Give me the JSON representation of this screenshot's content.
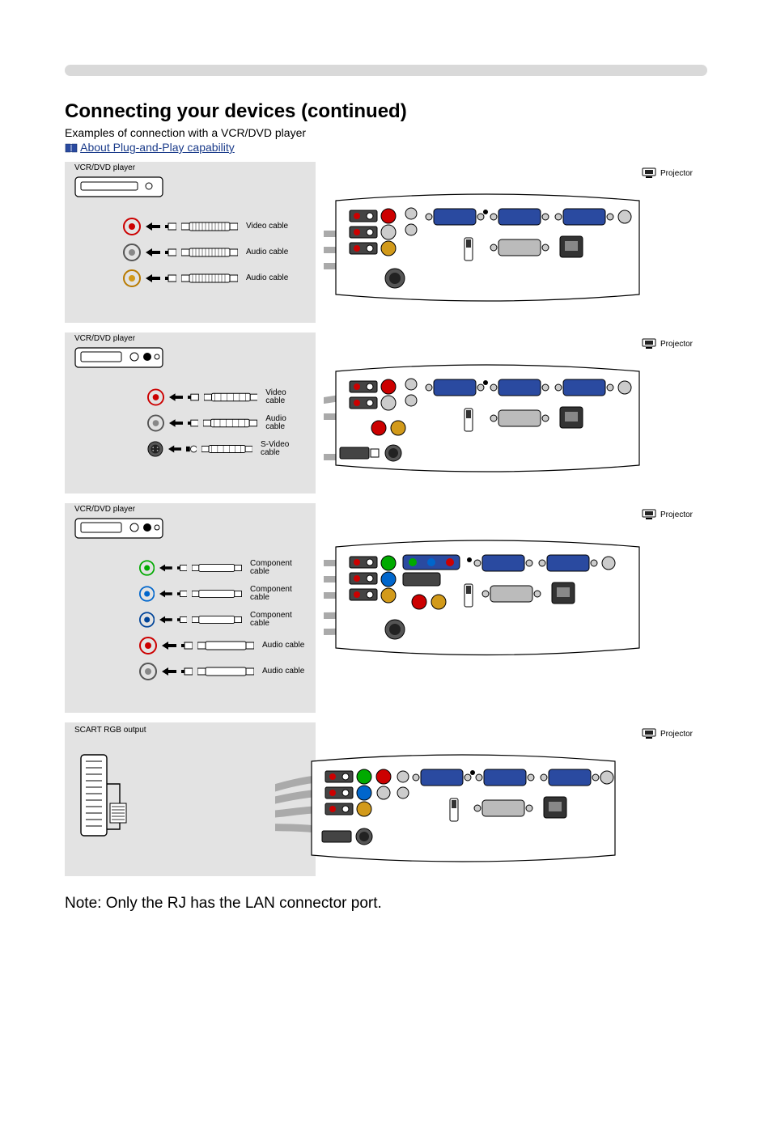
{
  "section_title": "Connecting your devices (continued)",
  "section_sub": "Examples of connection with a VCR/DVD player",
  "ref_prefix": "",
  "ref_link": "About Plug-and-Play capability",
  "proj_label": "Projector",
  "blocks": [
    {
      "src_label": "VCR/DVD player",
      "cables": [
        {
          "jack": "red",
          "label": "Video cable"
        },
        {
          "jack": "grey",
          "label": "Audio cable"
        },
        {
          "jack": "gold",
          "label": "Audio cable"
        }
      ]
    },
    {
      "src_label": "VCR/DVD player",
      "cables": [
        {
          "jack": "red",
          "label": "Video cable"
        },
        {
          "jack": "grey",
          "label": "Audio cable"
        },
        {
          "jack": "svideo",
          "label": "S-Video cable"
        }
      ]
    },
    {
      "src_label": "VCR/DVD player",
      "cables": [
        {
          "jack": "green",
          "label": "Component cable"
        },
        {
          "jack": "blue",
          "label": "Component cable"
        },
        {
          "jack": "bluec",
          "label": "Component cable"
        },
        {
          "jack": "red",
          "label": "Audio cable"
        },
        {
          "jack": "grey",
          "label": "Audio cable"
        }
      ]
    },
    {
      "src_label": "SCART RGB output",
      "cables": []
    }
  ],
  "note": "Note: Only the RJ has the LAN connector port."
}
